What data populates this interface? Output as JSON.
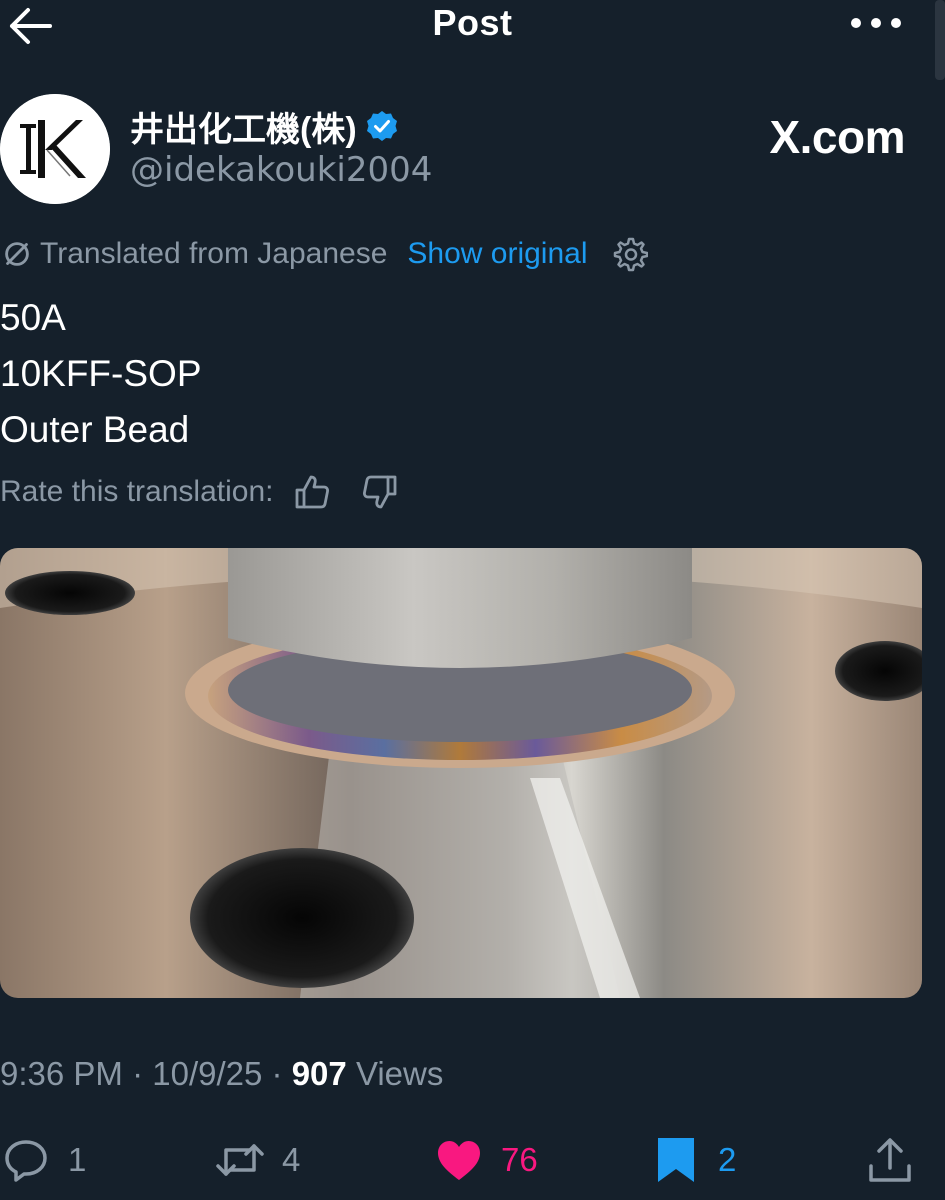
{
  "header": {
    "title": "Post"
  },
  "author": {
    "display_name": "井出化工機(株)",
    "handle": "@idekakouki2004",
    "site": "X.com"
  },
  "translation": {
    "label": "Translated from Japanese",
    "show_original": "Show original",
    "rate_label": "Rate this translation:"
  },
  "post": {
    "lines": [
      "50A",
      "10KFF-SOP",
      "Outer Bead"
    ]
  },
  "meta": {
    "time": "9:36 PM",
    "date": "10/9/25",
    "separator": "·",
    "views_count": "907",
    "views_label": "Views"
  },
  "actions": {
    "replies": "1",
    "reposts": "4",
    "likes": "76",
    "bookmarks": "2"
  },
  "icons": {
    "back": "arrow-left-icon",
    "more": "more-horizontal-icon",
    "verified": "verified-badge-icon",
    "translate": "translate-icon",
    "settings": "gear-icon",
    "thumbs_up": "thumbs-up-icon",
    "thumbs_down": "thumbs-down-icon",
    "reply": "reply-icon",
    "repost": "repost-icon",
    "like": "heart-icon",
    "bookmark": "bookmark-icon",
    "share": "share-icon"
  },
  "colors": {
    "background": "#15202b",
    "accent": "#1d9bf0",
    "muted": "#8b98a5",
    "like": "#f91880"
  }
}
